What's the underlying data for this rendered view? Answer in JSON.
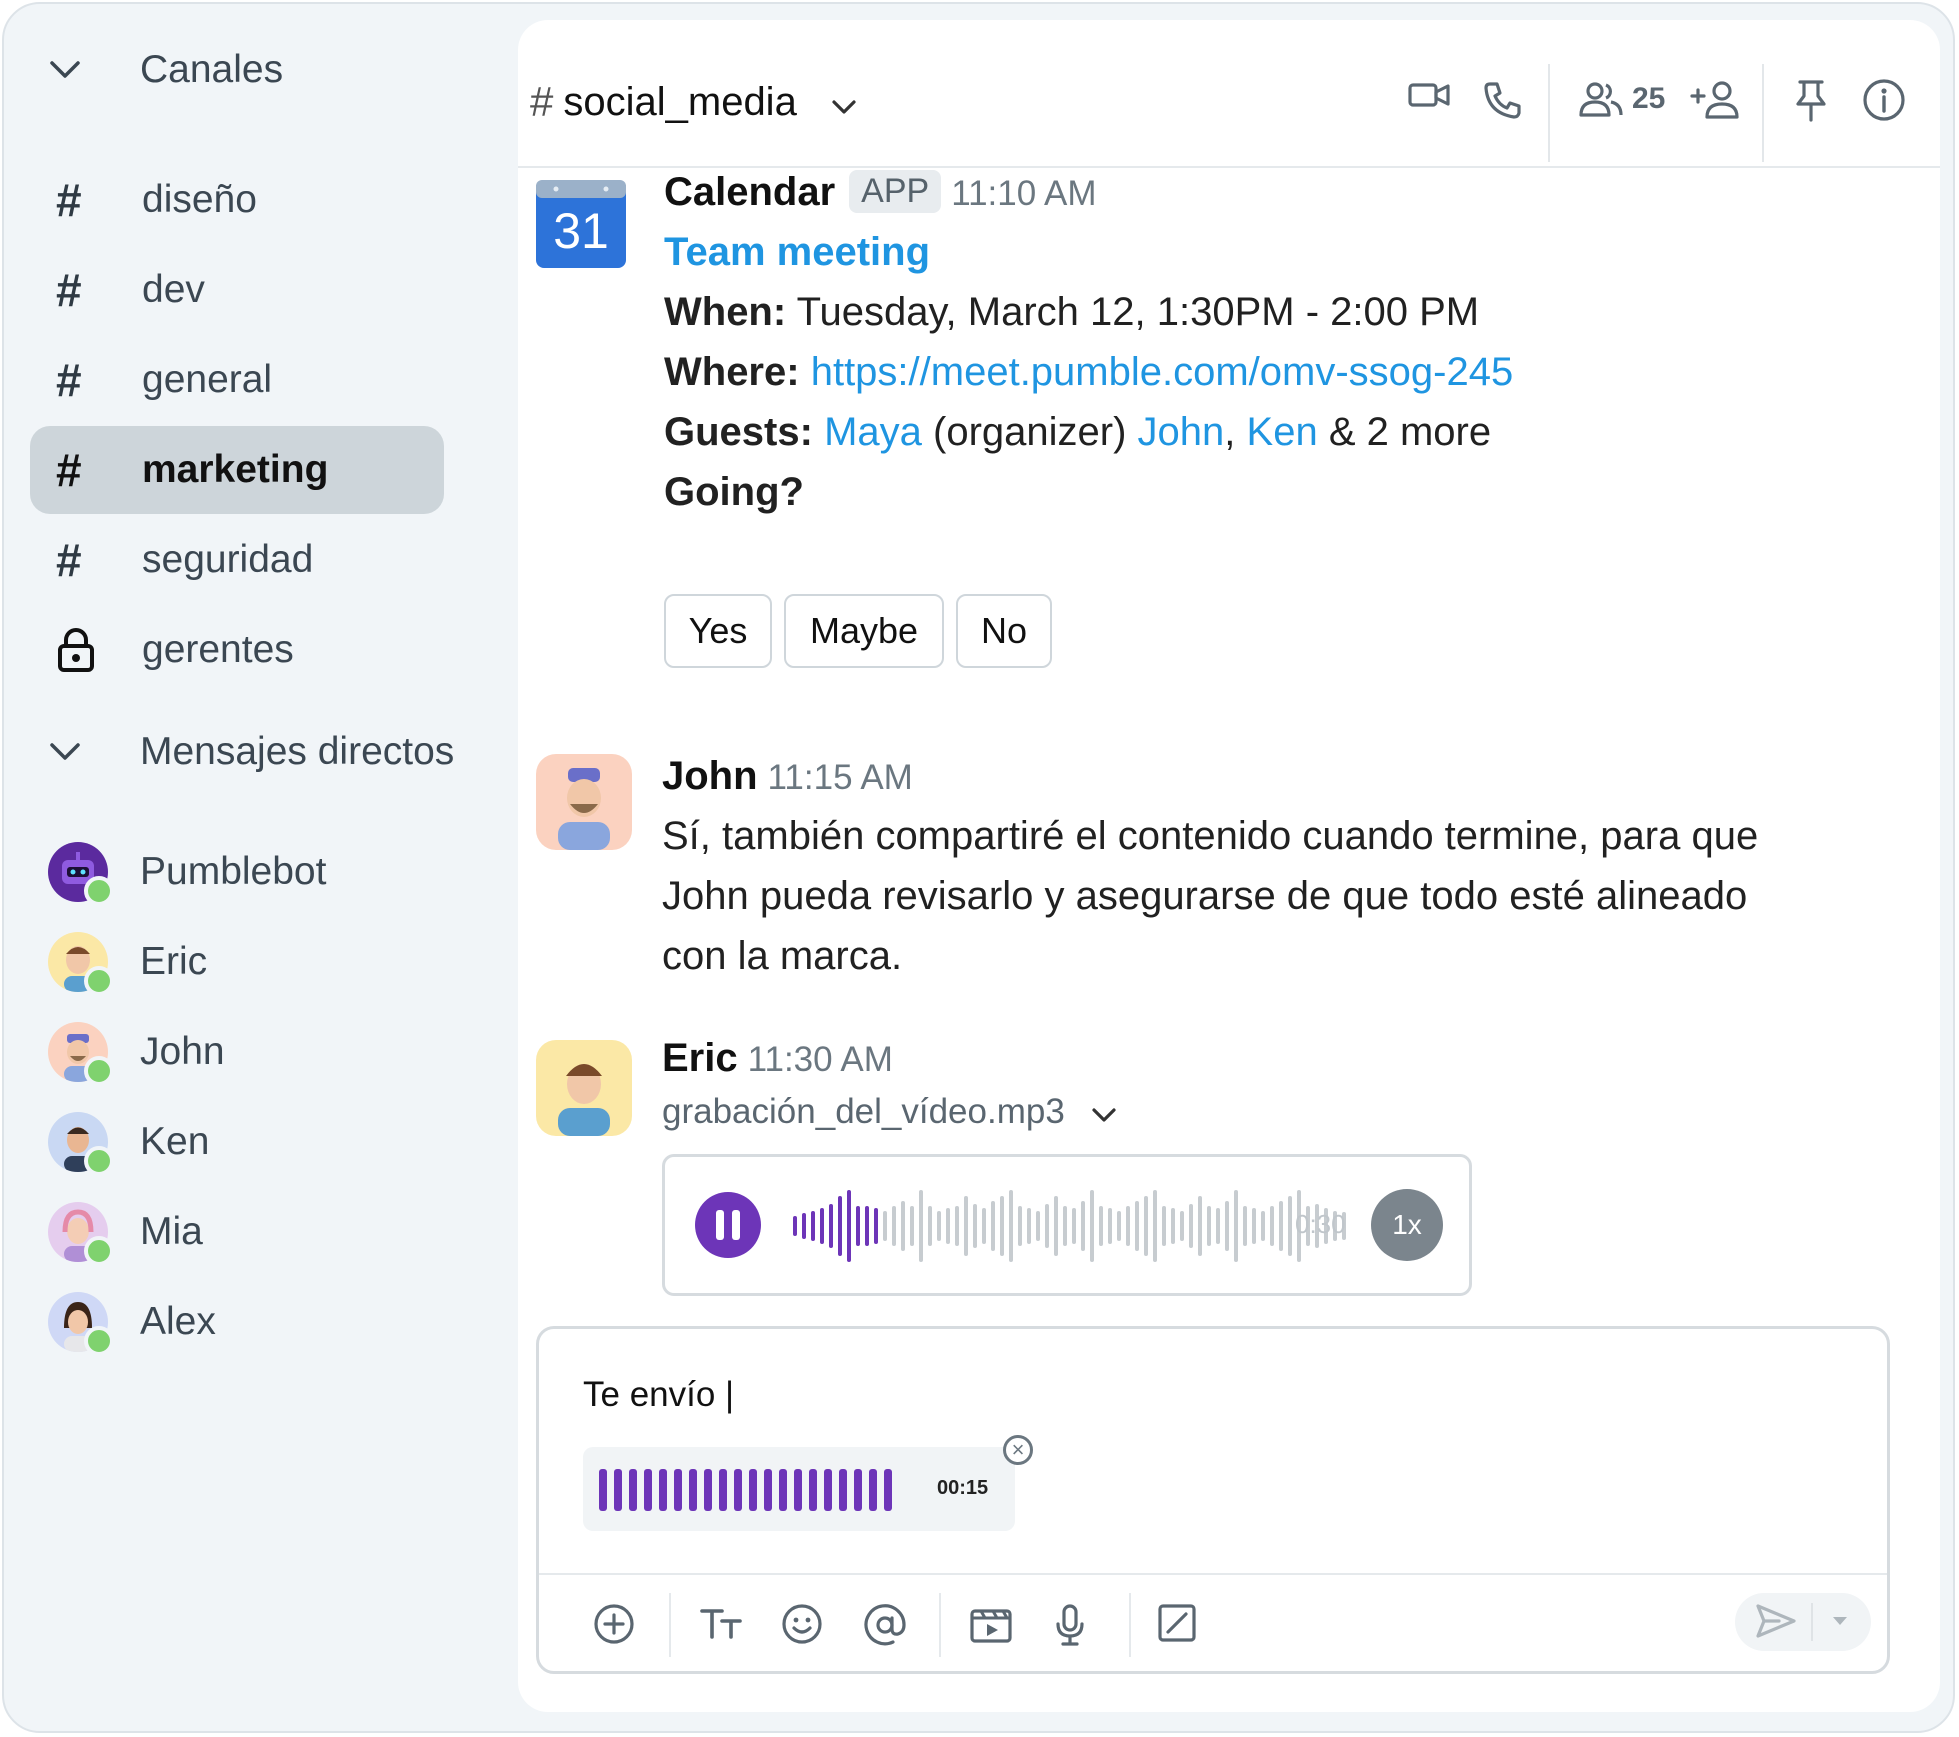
{
  "sidebar": {
    "channels_header": "Canales",
    "channels": [
      {
        "name": "diseño",
        "icon": "hash-icon"
      },
      {
        "name": "dev",
        "icon": "hash-icon"
      },
      {
        "name": "general",
        "icon": "hash-icon"
      },
      {
        "name": "marketing",
        "icon": "hash-icon",
        "active": true
      },
      {
        "name": "seguridad",
        "icon": "hash-icon"
      },
      {
        "name": "gerentes",
        "icon": "lock-icon"
      }
    ],
    "dm_header": "Mensajes directos",
    "dms": [
      {
        "name": "Pumblebot",
        "status": "online"
      },
      {
        "name": "Eric",
        "status": "online"
      },
      {
        "name": "John",
        "status": "online"
      },
      {
        "name": "Ken",
        "status": "online"
      },
      {
        "name": "Mia",
        "status": "online"
      },
      {
        "name": "Alex",
        "status": "online"
      }
    ]
  },
  "header": {
    "hash": "#",
    "channel": "social_media",
    "members_count": "25"
  },
  "messages": {
    "calendar": {
      "sender": "Calendar",
      "badge": "APP",
      "time": "11:10 AM",
      "icon_day": "31",
      "title": "Team meeting",
      "when_label": "When:",
      "when_value": "Tuesday, March 12, 1:30PM - 2:00 PM",
      "where_label": "Where:",
      "where_value": "https://meet.pumble.com/omv-ssog-245",
      "guests_label": "Guests:",
      "guest_1": "Maya",
      "guest_1_note": "(organizer)",
      "guest_2": "John",
      "comma": ",",
      "guest_3": "Ken",
      "guests_more": "& 2 more",
      "going_label": "Going?",
      "buttons": {
        "yes": "Yes",
        "maybe": "Maybe",
        "no": "No"
      }
    },
    "john": {
      "sender": "John",
      "time": "11:15 AM",
      "lines": [
        "Sí, también compartiré el contenido cuando termine, para que",
        "John pueda revisarlo y asegurarse de que todo esté alineado",
        "con la marca."
      ]
    },
    "eric": {
      "sender": "Eric",
      "time": "11:30 AM",
      "file_name": "grabación_del_vídeo.mp3",
      "duration": "0:30",
      "speed": "1x",
      "progress": 0.14
    }
  },
  "composer": {
    "text": "Te envío |",
    "recording_time": "00:15"
  },
  "colors": {
    "accent": "#6d35b8",
    "link": "#1f95e1",
    "online": "#7fd26e",
    "sidebar_bg": "#f1f5f8",
    "active_item": "#cdd5da"
  }
}
